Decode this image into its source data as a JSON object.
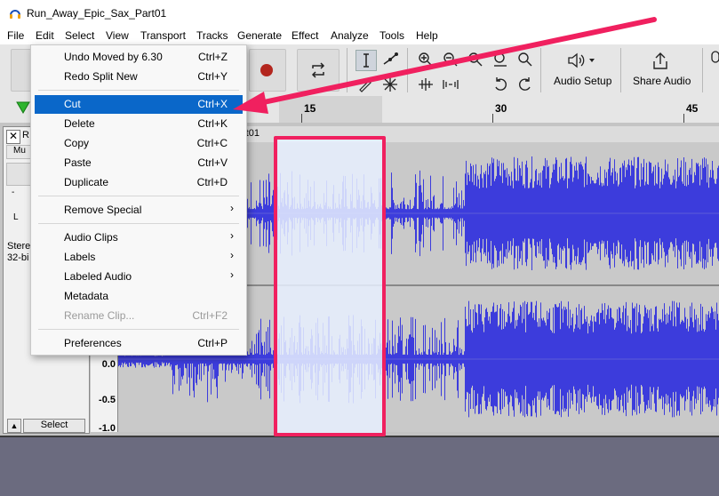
{
  "window": {
    "title": "Run_Away_Epic_Sax_Part01"
  },
  "menubar": [
    "File",
    "Edit",
    "Select",
    "View",
    "Transport",
    "Tracks",
    "Generate",
    "Effect",
    "Analyze",
    "Tools",
    "Help"
  ],
  "toolbar": {
    "audio_setup_label": "Audio Setup",
    "share_audio_label": "Share Audio"
  },
  "timeline": {
    "ticks": [
      "15",
      "30",
      "45"
    ]
  },
  "track": {
    "name_partial": "R",
    "clip_name_partial": "rt01",
    "mute_partial": "Mu",
    "info_line1": "Stere",
    "info_line2": "32-bi",
    "gain_partial": "-",
    "pan_partial": "L",
    "select_label": "Select"
  },
  "ruler": {
    "labels": [
      "0.0",
      "-0.5",
      "-1.0"
    ]
  },
  "edit_menu": {
    "items": [
      {
        "label": "Undo Moved by 6.30",
        "shortcut": "Ctrl+Z"
      },
      {
        "label": "Redo Split New",
        "shortcut": "Ctrl+Y"
      },
      {
        "label": "Cut",
        "shortcut": "Ctrl+X"
      },
      {
        "label": "Delete",
        "shortcut": "Ctrl+K"
      },
      {
        "label": "Copy",
        "shortcut": "Ctrl+C"
      },
      {
        "label": "Paste",
        "shortcut": "Ctrl+V"
      },
      {
        "label": "Duplicate",
        "shortcut": "Ctrl+D"
      },
      {
        "label": "Remove Special",
        "submenu": "›"
      },
      {
        "label": "Audio Clips",
        "submenu": "›"
      },
      {
        "label": "Labels",
        "submenu": "›"
      },
      {
        "label": "Labeled Audio",
        "submenu": "›"
      },
      {
        "label": "Metadata"
      },
      {
        "label": "Rename Clip...",
        "shortcut": "Ctrl+F2"
      },
      {
        "label": "Preferences",
        "shortcut": "Ctrl+P"
      }
    ]
  },
  "colors": {
    "accent": "#0a67c9",
    "waveform": "#3c3cdc",
    "highlight_border": "#f0205f",
    "arrow": "#f0205f",
    "record": "#b3261e"
  }
}
